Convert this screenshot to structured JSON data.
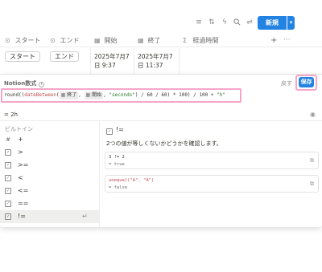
{
  "toolbar": {
    "icons": [
      "filter-icon",
      "sort-icon",
      "automation-icon",
      "search-icon",
      "settings-icon"
    ],
    "new_label": "新規"
  },
  "columns": [
    {
      "icon": "button-icon",
      "label": "スタート"
    },
    {
      "icon": "button-icon",
      "label": "エンド"
    },
    {
      "icon": "calendar-icon",
      "label": "開始"
    },
    {
      "icon": "calendar-icon",
      "label": "終了"
    },
    {
      "icon": "sigma-icon",
      "label": "経過時間"
    }
  ],
  "row": {
    "start_button": "スタート",
    "end_button": "エンド",
    "start_date_1": "2025年7月7",
    "start_date_2": "日 9:37",
    "end_date_1": "2025年7月7",
    "end_date_2": "日 11:37"
  },
  "editor": {
    "title": "Notion数式",
    "revert_label": "戻す",
    "save_label": "保存",
    "formula": {
      "p1": "round((",
      "fn": "dateBetween",
      "p2": "(",
      "chip1": "終了",
      "p3": ",",
      "chip2": "開始",
      "p4": ",",
      "str1": "\"seconds\"",
      "p5": ") / 60 / 60) * 100) / 100 +",
      "str2": "\"h\""
    },
    "result": "= 2h"
  },
  "list": {
    "section": "ビルトイン",
    "items": [
      {
        "icon": "#",
        "label": "+"
      },
      {
        "icon": "☑",
        "label": ">"
      },
      {
        "icon": "☑",
        "label": ">="
      },
      {
        "icon": "☑",
        "label": "<"
      },
      {
        "icon": "☑",
        "label": "<="
      },
      {
        "icon": "☑",
        "label": "=="
      },
      {
        "icon": "☑",
        "label": "!="
      }
    ]
  },
  "detail": {
    "title": "!=",
    "description": "2つの値が等しくないかどうかを確認します。",
    "examples": [
      {
        "code": "3 != 2",
        "result": "= true"
      },
      {
        "code": "unequal(\"A\", \"A\")",
        "result": "= false"
      }
    ]
  },
  "colors": {
    "accent": "#2383e2",
    "highlight": "#f4a6c8"
  }
}
